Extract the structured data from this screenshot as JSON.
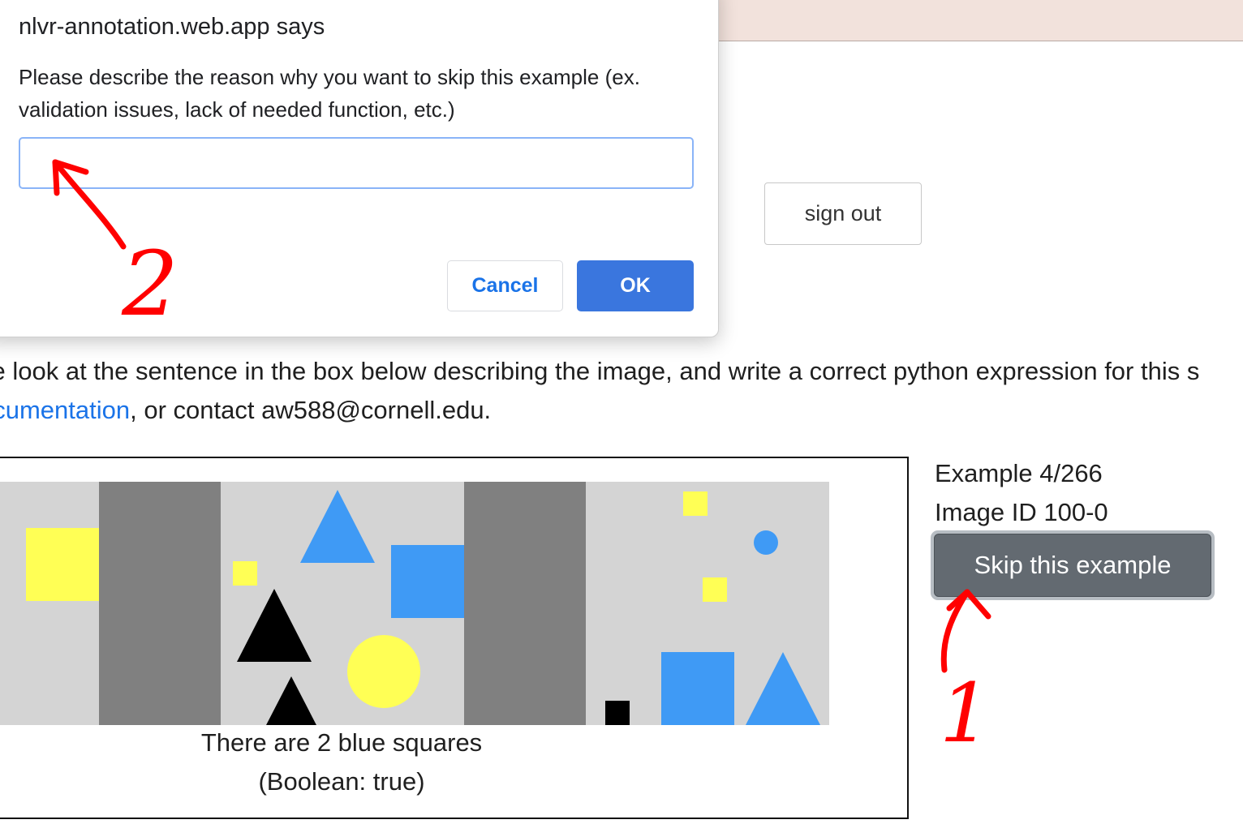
{
  "dialog": {
    "title": "nlvr-annotation.web.app says",
    "message": "Please describe the reason why you want to skip this example (ex. validation issues, lack of needed function, etc.)",
    "input_value": "",
    "cancel_label": "Cancel",
    "ok_label": "OK"
  },
  "header": {
    "sign_out_label": "sign out"
  },
  "instructions": {
    "line1": "se look at the sentence in the box below describing the image, and write a correct python expression for this s",
    "link_text": "ocumentation",
    "line2_rest": ", or contact aw588@cornell.edu."
  },
  "example": {
    "sentence": "There are 2 blue squares",
    "label": "(Boolean: true)"
  },
  "info": {
    "example_counter": "Example 4/266",
    "image_id": "Image ID 100-0",
    "skip_label": "Skip this example"
  },
  "annotations": {
    "arrow_1_label": "1",
    "arrow_2_label": "2"
  },
  "colors": {
    "accent_blue": "#1a73e8",
    "ok_button": "#3a76de",
    "skip_button": "#636a71",
    "topbar": "#f2e2dc",
    "scene_background": "#d4d4d4",
    "scene_separator": "#808080",
    "shape_yellow": "#ffff55",
    "shape_blue": "#3f9af5",
    "shape_black": "#000000",
    "annotation_red": "#ff0000"
  }
}
